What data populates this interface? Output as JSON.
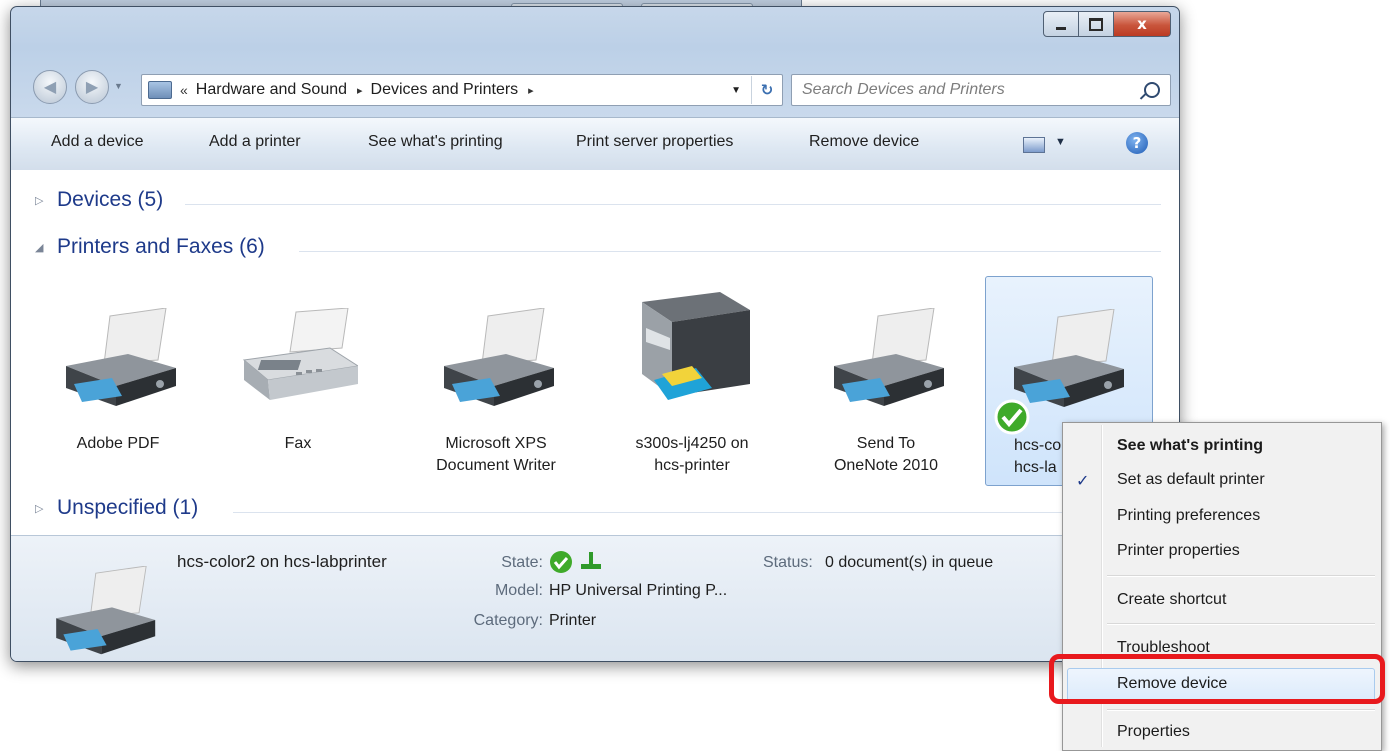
{
  "window": {
    "controls": {
      "minimize": "",
      "maximize": "",
      "close": "x"
    }
  },
  "address_bar": {
    "overflow": "«",
    "crumbs": [
      "Hardware and Sound",
      "Devices and Printers"
    ],
    "separator": "▸"
  },
  "search": {
    "placeholder": "Search Devices and Printers"
  },
  "toolbar": {
    "items": [
      "Add a device",
      "Add a printer",
      "See what's printing",
      "Print server properties",
      "Remove device"
    ],
    "help": "?"
  },
  "groups": {
    "devices": "Devices (5)",
    "printers": "Printers and Faxes (6)",
    "unspecified": "Unspecified (1)"
  },
  "devices": [
    {
      "line1": "Adobe PDF",
      "line2": "",
      "icon": "printer-icon"
    },
    {
      "line1": "Fax",
      "line2": "",
      "icon": "fax-icon"
    },
    {
      "line1": "Microsoft XPS",
      "line2": "Document Writer",
      "icon": "printer-icon"
    },
    {
      "line1": "s300s-lj4250 on",
      "line2": "hcs-printer",
      "icon": "multifunction-printer-icon"
    },
    {
      "line1": "Send To",
      "line2": "OneNote 2010",
      "icon": "printer-icon"
    },
    {
      "line1": "hcs-co",
      "line2": "hcs-la",
      "icon": "printer-icon"
    }
  ],
  "details": {
    "name": "hcs-color2 on hcs-labprinter",
    "state_label": "State:",
    "status_label": "Status:",
    "status_value": "0 document(s) in queue",
    "model_label": "Model:",
    "model_value": "HP Universal Printing P...",
    "category_label": "Category:",
    "category_value": "Printer"
  },
  "context_menu": {
    "items": [
      "See what's printing",
      "Set as default printer",
      "Printing preferences",
      "Printer properties",
      "Create shortcut",
      "Troubleshoot",
      "Remove device",
      "Properties"
    ],
    "check": "✓",
    "highlighted": "Remove device",
    "highlight_color": "#e8191d"
  }
}
